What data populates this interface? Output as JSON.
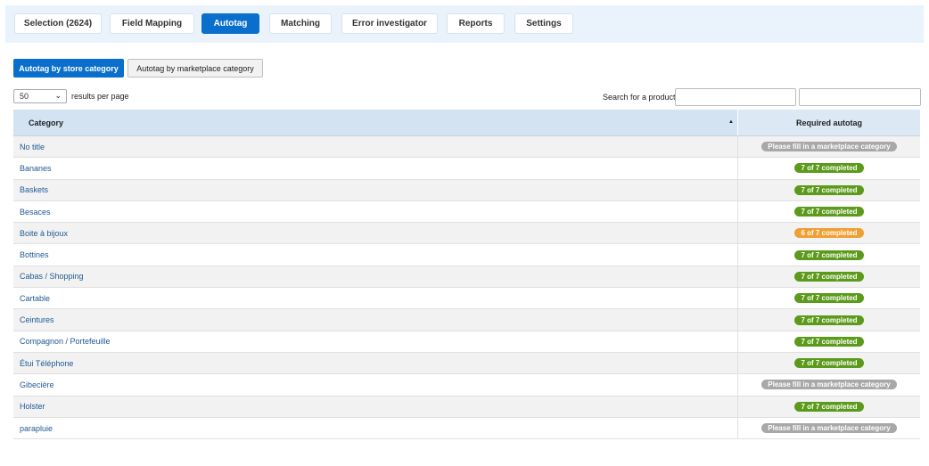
{
  "nav": {
    "tabs": [
      {
        "label": "Selection (2624)",
        "active": false
      },
      {
        "label": "Field Mapping",
        "active": false
      },
      {
        "label": "Autotag",
        "active": true
      },
      {
        "label": "Matching",
        "active": false
      },
      {
        "label": "Error investigator",
        "active": false
      },
      {
        "label": "Reports",
        "active": false
      },
      {
        "label": "Settings",
        "active": false
      }
    ]
  },
  "subtabs": {
    "store_category": "Autotag by store category",
    "marketplace_category": "Autotag by marketplace category"
  },
  "controls": {
    "per_page_value": "50",
    "per_page_label": "results per page",
    "search_label": "Search for a product:"
  },
  "table": {
    "headers": {
      "category": "Category",
      "required": "Required autotag"
    },
    "rows": [
      {
        "category": "No title",
        "status": "Please fill in a marketplace category",
        "state": "missing"
      },
      {
        "category": "Bananes",
        "status": "7 of 7 completed",
        "state": "complete"
      },
      {
        "category": "Baskets",
        "status": "7 of 7 completed",
        "state": "complete"
      },
      {
        "category": "Besaces",
        "status": "7 of 7 completed",
        "state": "complete"
      },
      {
        "category": "Boite à bijoux",
        "status": "6 of 7 completed",
        "state": "partial"
      },
      {
        "category": "Bottines",
        "status": "7 of 7 completed",
        "state": "complete"
      },
      {
        "category": "Cabas / Shopping",
        "status": "7 of 7 completed",
        "state": "complete"
      },
      {
        "category": "Cartable",
        "status": "7 of 7 completed",
        "state": "complete"
      },
      {
        "category": "Ceintures",
        "status": "7 of 7 completed",
        "state": "complete"
      },
      {
        "category": "Compagnon / Portefeuille",
        "status": "7 of 7 completed",
        "state": "complete"
      },
      {
        "category": "Étui Téléphone",
        "status": "7 of 7 completed",
        "state": "complete"
      },
      {
        "category": "Gibecière",
        "status": "Please fill in a marketplace category",
        "state": "missing"
      },
      {
        "category": "Holster",
        "status": "7 of 7 completed",
        "state": "complete"
      },
      {
        "category": "parapluie",
        "status": "Please fill in a marketplace category",
        "state": "missing"
      }
    ]
  },
  "colors": {
    "primary": "#0a6fcc",
    "complete": "#5b9a1a",
    "partial": "#f0a032",
    "missing": "#a8a8a8",
    "link": "#1f5a94"
  }
}
